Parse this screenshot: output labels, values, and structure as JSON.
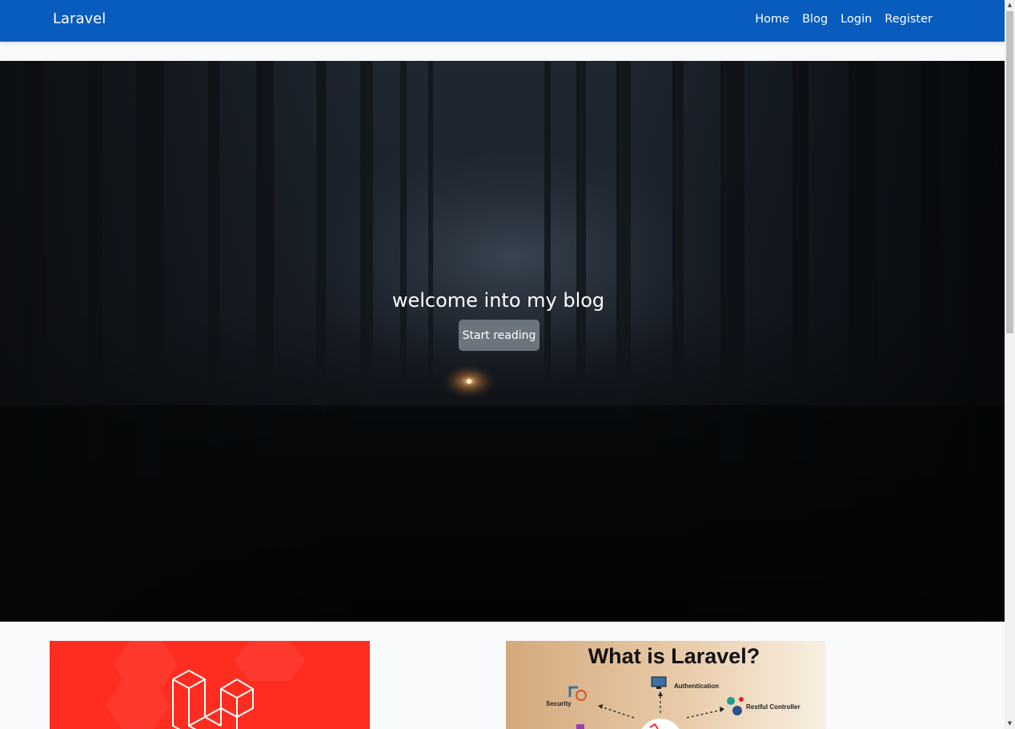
{
  "navbar": {
    "brand": "Laravel",
    "links": [
      "Home",
      "Blog",
      "Login",
      "Register"
    ]
  },
  "hero": {
    "title": "welcome into my blog",
    "button_label": "Start reading"
  },
  "cards": [
    {
      "image": "laravel-logo"
    },
    {
      "image": "what-is-laravel-diagram",
      "title": "What is Laravel?",
      "labels": [
        "Authentication",
        "Security",
        "Restful Controller"
      ]
    }
  ],
  "colors": {
    "navbar": "#075cbd",
    "page_bg": "#f8fafc",
    "button": "#6c757d",
    "laravel_red": "#ff2d20"
  }
}
